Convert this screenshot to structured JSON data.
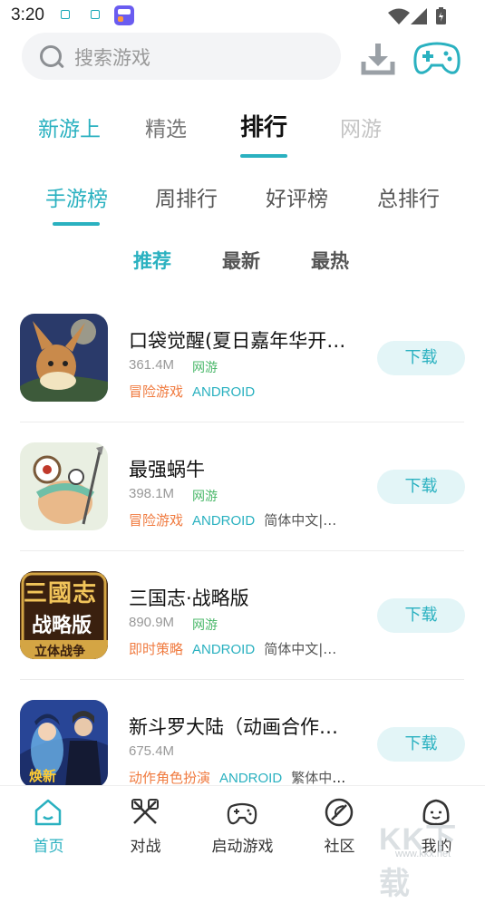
{
  "status_bar": {
    "time": "3:20"
  },
  "search": {
    "placeholder": "搜索游戏"
  },
  "top_tabs": [
    "新游上",
    "精选",
    "排行",
    "网游"
  ],
  "rank_tabs": [
    "手游榜",
    "周排行",
    "好评榜",
    "总排行"
  ],
  "sort_tabs": [
    "推荐",
    "最新",
    "最热"
  ],
  "games": [
    {
      "name": "口袋觉醒(夏日嘉年华开…",
      "size": "361.4M",
      "type": "网游",
      "tags": [
        "冒险游戏",
        "ANDROID"
      ],
      "button": "下载"
    },
    {
      "name": "最强蜗牛",
      "size": "398.1M",
      "type": "网游",
      "tags": [
        "冒险游戏",
        "ANDROID",
        "简体中文|…"
      ],
      "button": "下载"
    },
    {
      "name": "三国志·战略版",
      "size": "890.9M",
      "type": "网游",
      "tags": [
        "即时策略",
        "ANDROID",
        "简体中文|…"
      ],
      "button": "下载"
    },
    {
      "name": "新斗罗大陆（动画合作…",
      "size": "675.4M",
      "type": "",
      "tags": [
        "动作角色扮演",
        "ANDROID",
        "繁体中…"
      ],
      "button": "下载"
    }
  ],
  "icon_text": {
    "sanguo": "三國志",
    "sanguo_sub": "战略版",
    "sanguo_banner": "立体战争",
    "douluo_badge": "焕新"
  },
  "bottom_nav": [
    "首页",
    "对战",
    "启动游戏",
    "社区",
    "我的"
  ],
  "watermark": {
    "main": "KK下载",
    "url": "www.kkx.net"
  },
  "colors": {
    "accent": "#2ab1c0",
    "tag_orange": "#f07b40",
    "tag_green": "#4cb86b",
    "button_bg": "#e3f5f7"
  }
}
